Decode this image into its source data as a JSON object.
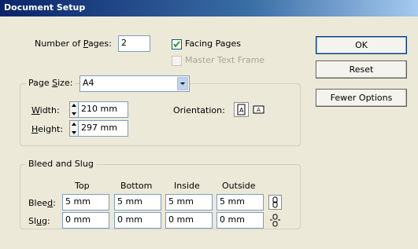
{
  "window": {
    "title": "Document Setup"
  },
  "pages": {
    "label": "Number of Pages:",
    "value": "2"
  },
  "facing_pages": {
    "label": "Facing Pages",
    "checked": true
  },
  "master_text_frame": {
    "label": "Master Text Frame",
    "checked": false,
    "enabled": false
  },
  "buttons": {
    "ok": "OK",
    "reset": "Reset",
    "fewer_options": "Fewer Options"
  },
  "page_size": {
    "label": "Page Size:",
    "value": "A4"
  },
  "width": {
    "label": "Width:",
    "value": "210 mm"
  },
  "height": {
    "label": "Height:",
    "value": "297 mm"
  },
  "orientation": {
    "label": "Orientation:"
  },
  "bleed_slug": {
    "title": "Bleed and Slug",
    "columns": [
      "Top",
      "Bottom",
      "Inside",
      "Outside"
    ],
    "bleed_label": "Bleed:",
    "bleed": [
      "5 mm",
      "5 mm",
      "5 mm",
      "5 mm"
    ],
    "slug_label": "Slug:",
    "slug": [
      "0 mm",
      "0 mm",
      "0 mm",
      "0 mm"
    ]
  },
  "icons": {
    "portrait": "portrait-orientation-icon",
    "landscape": "landscape-orientation-icon",
    "bleed_link": "chain-link-icon",
    "slug_link": "broken-chain-icon"
  }
}
